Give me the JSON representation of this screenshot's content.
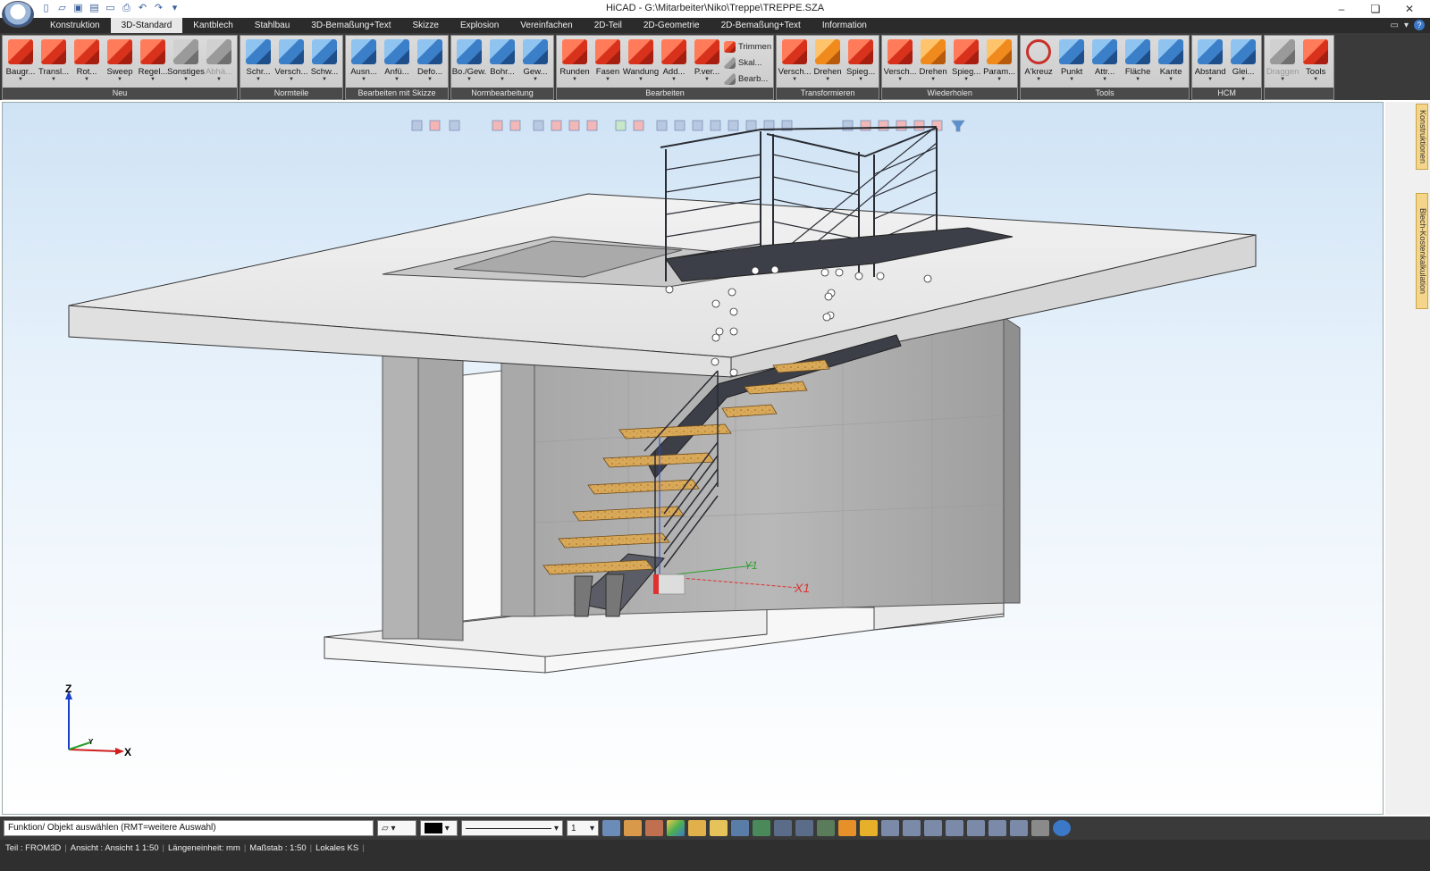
{
  "window": {
    "title": "HiCAD - G:\\Mitarbeiter\\Niko\\Treppe\\TREPPE.SZA",
    "controls": [
      "–",
      "❏",
      "✕"
    ]
  },
  "tabs": [
    "Konstruktion",
    "3D-Standard",
    "Kantblech",
    "Stahlbau",
    "3D-Bemaßung+Text",
    "Skizze",
    "Explosion",
    "Vereinfachen",
    "2D-Teil",
    "2D-Geometrie",
    "2D-Bemaßung+Text",
    "Information"
  ],
  "active_tab": "3D-Standard",
  "ribbon": {
    "groups": [
      {
        "label": "Neu",
        "buttons": [
          {
            "label": "Baugr...",
            "icon": "assembly-icon"
          },
          {
            "label": "Transl...",
            "icon": "translation-icon"
          },
          {
            "label": "Rot...",
            "icon": "rotation-icon"
          },
          {
            "label": "Sweep",
            "icon": "sweep-icon"
          },
          {
            "label": "Regel...",
            "icon": "ruled-surface-icon"
          },
          {
            "label": "Sonstiges",
            "icon": "misc-icon"
          },
          {
            "label": "Abhä...",
            "icon": "dependent-icon",
            "disabled": true
          }
        ]
      },
      {
        "label": "Normteile",
        "buttons": [
          {
            "label": "Schr...",
            "icon": "screw-icon"
          },
          {
            "label": "Versch...",
            "icon": "bolt-icon"
          },
          {
            "label": "Schw...",
            "icon": "weld-icon"
          }
        ]
      },
      {
        "label": "Bearbeiten mit Skizze",
        "buttons": [
          {
            "label": "Ausn...",
            "icon": "cutout-icon"
          },
          {
            "label": "Anfü...",
            "icon": "extrude-icon"
          },
          {
            "label": "Defo...",
            "icon": "deform-icon"
          }
        ]
      },
      {
        "label": "Normbearbeitung",
        "buttons": [
          {
            "label": "Bo./Gew.",
            "icon": "bore-thread-icon"
          },
          {
            "label": "Bohr...",
            "icon": "drill-icon"
          },
          {
            "label": "Gew...",
            "icon": "thread-icon"
          }
        ]
      },
      {
        "label": "Bearbeiten",
        "buttons": [
          {
            "label": "Runden",
            "icon": "round-icon"
          },
          {
            "label": "Fasen",
            "icon": "chamfer-icon"
          },
          {
            "label": "Wandung",
            "icon": "shell-icon"
          },
          {
            "label": "Add...",
            "icon": "add-icon"
          },
          {
            "label": "P.ver...",
            "icon": "point-move-icon"
          }
        ],
        "small": [
          "Trimmen",
          "Skal...",
          "Bearb..."
        ]
      },
      {
        "label": "Transformieren",
        "buttons": [
          {
            "label": "Versch...",
            "icon": "move-icon"
          },
          {
            "label": "Drehen",
            "icon": "rotate-icon"
          },
          {
            "label": "Spieg...",
            "icon": "mirror-icon"
          }
        ]
      },
      {
        "label": "Wiederholen",
        "buttons": [
          {
            "label": "Versch...",
            "icon": "repeat-move-icon"
          },
          {
            "label": "Drehen",
            "icon": "repeat-rotate-icon"
          },
          {
            "label": "Spieg...",
            "icon": "repeat-mirror-icon"
          },
          {
            "label": "Param...",
            "icon": "parametric-icon"
          }
        ]
      },
      {
        "label": "Tools",
        "buttons": [
          {
            "label": "A'kreuz",
            "icon": "crosshair-icon"
          },
          {
            "label": "Punkt",
            "icon": "point-icon"
          },
          {
            "label": "Attr...",
            "icon": "attributes-icon"
          },
          {
            "label": "Fläche",
            "icon": "face-icon"
          },
          {
            "label": "Kante",
            "icon": "edge-icon"
          }
        ]
      },
      {
        "label": "HCM",
        "buttons": [
          {
            "label": "Abstand",
            "icon": "distance-icon"
          },
          {
            "label": "Glei...",
            "icon": "equation-icon"
          }
        ]
      },
      {
        "label": "",
        "buttons": [
          {
            "label": "Draggen",
            "icon": "drag-icon",
            "disabled": true
          },
          {
            "label": "Tools",
            "icon": "tools-icon"
          }
        ]
      }
    ]
  },
  "side_tabs": [
    "Konstruktionen",
    "Blech-Kostenkalkulation"
  ],
  "viewport": {
    "axes": {
      "z": "Z",
      "y": "Y",
      "x": "X"
    },
    "labels": {
      "x1": "X1",
      "y1": "Y1"
    }
  },
  "bottom_toolbar": {
    "command_prompt": "Funktion/ Objekt auswählen (RMT=weitere Auswahl)",
    "line_width": "1"
  },
  "status_bar": {
    "part": "Teil : FROM3D",
    "view": "Ansicht : Ansicht 1 1:50",
    "unit": "Längeneinheit: mm",
    "scale": "Maßstab : 1:50",
    "ks": "Lokales KS"
  },
  "colors": {
    "accent": "#3b78c8",
    "ribbon_bg": "#3a3a3a",
    "wood": "#d9a95a",
    "steel": "#3d3f48",
    "concrete": "#b9b9b9"
  }
}
